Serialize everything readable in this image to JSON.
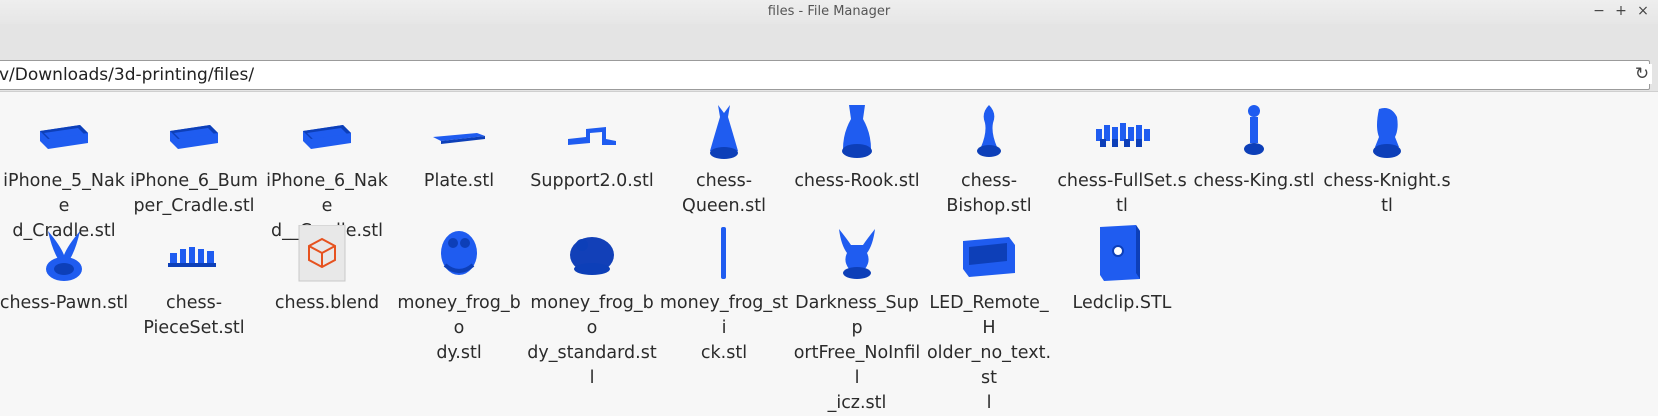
{
  "window": {
    "title": "files - File Manager",
    "minimize_icon": "minimize-icon",
    "maximize_icon": "maximize-icon",
    "close_icon": "close-icon"
  },
  "location": {
    "path": "v/Downloads/3d-printing/files/",
    "reload_icon": "reload-icon"
  },
  "colors": {
    "model_blue": "#1f5cf0",
    "model_shadow": "#0d3fb8",
    "blend_orange": "#e6521f"
  },
  "files": [
    {
      "name": "iPhone_5_Naked_Cradle.stl",
      "lines": [
        "iPhone_5_Nake",
        "d_Cradle.stl"
      ],
      "icon": "cradle-model-icon"
    },
    {
      "name": "iPhone_6_Bumper_Cradle.stl",
      "lines": [
        "iPhone_6_Bum",
        "per_Cradle.stl"
      ],
      "icon": "cradle-model-icon"
    },
    {
      "name": "iPhone_6_Naked__Cradle.stl",
      "lines": [
        "iPhone_6_Nake",
        "d__Cradle.stl"
      ],
      "icon": "cradle-model-icon"
    },
    {
      "name": "Plate.stl",
      "lines": [
        "Plate.stl"
      ],
      "icon": "plate-model-icon"
    },
    {
      "name": "Support2.0.stl",
      "lines": [
        "Support2.0.stl"
      ],
      "icon": "support-model-icon"
    },
    {
      "name": "chess-Queen.stl",
      "lines": [
        "chess-",
        "Queen.stl"
      ],
      "icon": "chess-queen-icon"
    },
    {
      "name": "chess-Rook.stl",
      "lines": [
        "chess-Rook.stl"
      ],
      "icon": "chess-rook-icon"
    },
    {
      "name": "chess-Bishop.stl",
      "lines": [
        "chess-",
        "Bishop.stl"
      ],
      "icon": "chess-bishop-icon"
    },
    {
      "name": "chess-FullSet.stl",
      "lines": [
        "chess-FullSet.stl"
      ],
      "icon": "chess-fullset-icon"
    },
    {
      "name": "chess-King.stl",
      "lines": [
        "chess-King.stl"
      ],
      "icon": "chess-king-icon"
    },
    {
      "name": "chess-Knight.stl",
      "lines": [
        "chess-Knight.stl"
      ],
      "icon": "chess-knight-icon"
    },
    {
      "name": "chess-Pawn.stl",
      "lines": [
        "chess-Pawn.stl"
      ],
      "icon": "chess-pawn-icon"
    },
    {
      "name": "chess-PieceSet.stl",
      "lines": [
        "chess-",
        "PieceSet.stl"
      ],
      "icon": "chess-pieceset-icon"
    },
    {
      "name": "chess.blend",
      "lines": [
        "chess.blend"
      ],
      "icon": "blend-file-icon"
    },
    {
      "name": "money_frog_body.stl",
      "lines": [
        "money_frog_bo",
        "dy.stl"
      ],
      "icon": "frog-model-icon"
    },
    {
      "name": "money_frog_body_standard.stl",
      "lines": [
        "money_frog_bo",
        "dy_standard.stl"
      ],
      "icon": "frog-standard-model-icon"
    },
    {
      "name": "money_frog_stick.stl",
      "lines": [
        "money_frog_sti",
        "ck.stl"
      ],
      "icon": "stick-model-icon"
    },
    {
      "name": "Darkness_SupportFree_NoInfill_icz.stl",
      "lines": [
        "Darkness_Supp",
        "ortFree_NoInfill",
        "_icz.stl"
      ],
      "icon": "darkness-model-icon"
    },
    {
      "name": "LED_Remote_Holder_no_text.stl",
      "lines": [
        "LED_Remote_H",
        "older_no_text.st",
        "l"
      ],
      "icon": "remote-holder-model-icon"
    },
    {
      "name": "Ledclip.STL",
      "lines": [
        "Ledclip.STL"
      ],
      "icon": "ledclip-model-icon"
    }
  ]
}
